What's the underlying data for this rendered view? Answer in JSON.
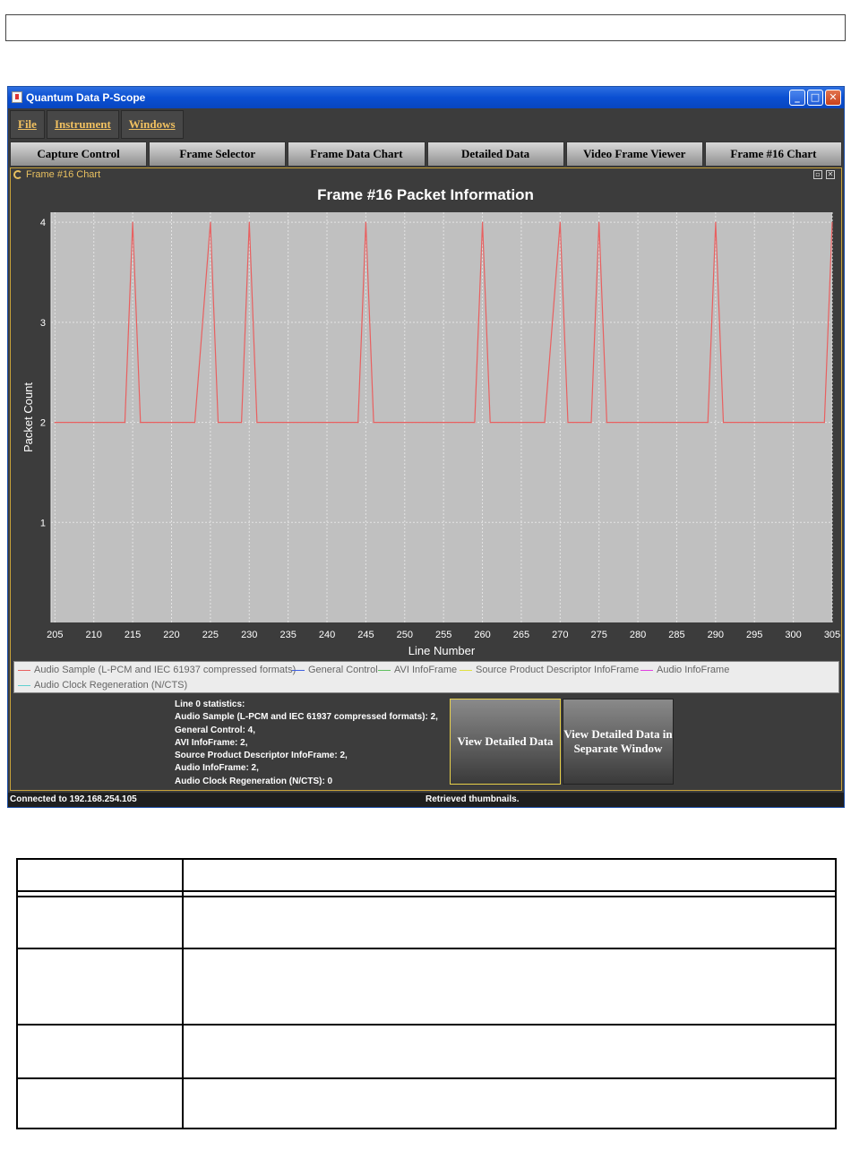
{
  "window": {
    "title": "Quantum Data P-Scope"
  },
  "menubar": {
    "items": [
      "File",
      "Instrument",
      "Windows"
    ]
  },
  "tabs": [
    "Capture Control",
    "Frame Selector",
    "Frame Data Chart",
    "Detailed Data",
    "Video Frame Viewer",
    "Frame #16 Chart"
  ],
  "internal_frame": {
    "title": "Frame #16 Chart"
  },
  "chart_data": {
    "type": "line",
    "title": "Frame #16 Packet Information",
    "xlabel": "Line Number",
    "ylabel": "Packet Count",
    "xlim": [
      204.5,
      305
    ],
    "ylim": [
      0,
      4.1
    ],
    "xticks": [
      205,
      210,
      215,
      220,
      225,
      230,
      235,
      240,
      245,
      250,
      255,
      260,
      265,
      270,
      275,
      280,
      285,
      290,
      295,
      300,
      305
    ],
    "yticks": [
      1,
      2,
      3,
      4
    ],
    "grid": true,
    "legend_position": "bottom",
    "series": [
      {
        "name": "Audio Sample (L-PCM and IEC 61937 compressed formats)",
        "color": "#e86060",
        "x": [
          205,
          214,
          215,
          216,
          223,
          225,
          226,
          229,
          230,
          231,
          244,
          245,
          246,
          259,
          260,
          261,
          268,
          270,
          271,
          274,
          275,
          276,
          289,
          290,
          291,
          304,
          305
        ],
        "y": [
          2,
          2,
          4,
          2,
          2,
          4,
          2,
          2,
          4,
          2,
          2,
          4,
          2,
          2,
          4,
          2,
          2,
          4,
          2,
          2,
          4,
          2,
          2,
          4,
          2,
          2,
          4
        ]
      },
      {
        "name": "General Control",
        "color": "#4060e0",
        "x": [],
        "y": []
      },
      {
        "name": "AVI InfoFrame",
        "color": "#60c060",
        "x": [],
        "y": []
      },
      {
        "name": "Source Product Descriptor InfoFrame",
        "color": "#e0e040",
        "x": [],
        "y": []
      },
      {
        "name": "Audio InfoFrame",
        "color": "#e040e0",
        "x": [],
        "y": []
      },
      {
        "name": "Audio Clock Regeneration (N/CTS)",
        "color": "#60d0d0",
        "x": [],
        "y": []
      }
    ]
  },
  "stats": {
    "lines": [
      "Line 0 statistics:",
      "Audio Sample (L-PCM and IEC 61937 compressed formats): 2,",
      "General Control: 4,",
      "AVI InfoFrame: 2,",
      "Source Product Descriptor InfoFrame: 2,",
      "Audio InfoFrame: 2,",
      "Audio Clock Regeneration (N/CTS): 0"
    ]
  },
  "buttons": {
    "view_detailed": "View Detailed Data",
    "view_separate": "View Detailed Data in Separate Window"
  },
  "status": {
    "connection": "Connected to 192.168.254.105",
    "message": "Retrieved thumbnails."
  }
}
